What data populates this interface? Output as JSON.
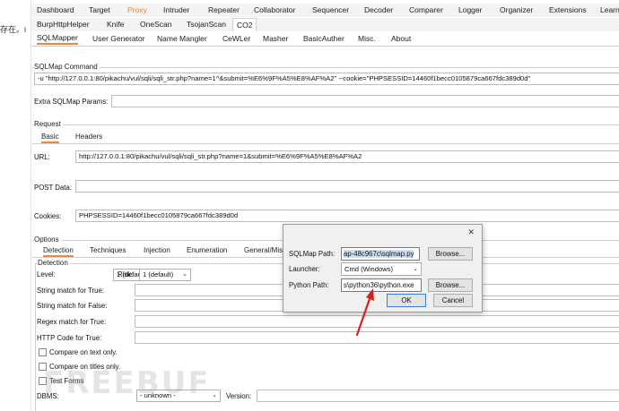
{
  "left_strip_text": "存在。i",
  "top_tabs": [
    "Dashboard",
    "Target",
    "Proxy",
    "Intruder",
    "Repeater",
    "Collaborator",
    "Sequencer",
    "Decoder",
    "Comparer",
    "Logger",
    "Organizer",
    "Extensions",
    "Learn"
  ],
  "ext_tabs": [
    "BurpHttpHelper",
    "Knife",
    "OneScan",
    "TsojanScan",
    "CO2"
  ],
  "co2_tabs": [
    "SQLMapper",
    "User Generator",
    "Name Mangler",
    "CeWLer",
    "Masher",
    "BasicAuther",
    "Misc.",
    "About"
  ],
  "sqlmap_command": {
    "title": "SQLMap Command",
    "value": "-u \"http://127.0.0.1:80/pikachu/vul/sqli/sqli_str.php?name=1^&submit=%E6%9F%A5%E8%AF%A2\" --cookie=\"PHPSESSID=14460f1becc0105879ca667fdc389d0d\"",
    "extra_label": "Extra SQLMap Params:",
    "extra_value": ""
  },
  "request": {
    "title": "Request",
    "tabs": [
      "Basic",
      "Headers"
    ],
    "url_label": "URL:",
    "url_value": "http://127.0.0.1:80/pikachu/vul/sqli/sqli_str.php?name=1&submit=%E6%9F%A5%E8%AF%A2",
    "post_label": "POST Data:",
    "post_value": "",
    "cookies_label": "Cookies:",
    "cookies_value": "PHPSESSID=14460f1becc0105879ca667fdc389d0d"
  },
  "options": {
    "title": "Options",
    "tabs": [
      "Detection",
      "Techniques",
      "Injection",
      "Enumeration",
      "General/Misc"
    ],
    "detection_title": "Detection",
    "level_label": "Level:",
    "level_value": "1 (default)",
    "risk_label": "Risk:",
    "risk_value": "1 (default)",
    "string_true_label": "String match for True:",
    "string_false_label": "String match for False:",
    "regex_true_label": "Regex match for True:",
    "http_code_label": "HTTP Code for True:",
    "compare_text_label": "Compare on text only.",
    "compare_titles_label": "Compare on titles only.",
    "test_forms_label": "Test Forms",
    "dbms_label": "DBMS:",
    "dbms_value": "- unknown -",
    "version_label": "Version:",
    "version_value": ""
  },
  "dialog": {
    "sqlmap_path_label": "SQLMap Path:",
    "sqlmap_path_value": "ap-48c967c\\sqlmap.py",
    "browse_label": "Browse...",
    "launcher_label": "Launcher:",
    "launcher_value": "Cmd (Windows)",
    "python_path_label": "Python Path:",
    "python_path_value": "s\\python36\\python.exe",
    "browse2_label": "Browse...",
    "ok_label": "OK",
    "cancel_label": "Cancel",
    "close_symbol": "✕"
  },
  "watermark": "FREEBUF",
  "colors": {
    "accent": "#e8893f",
    "arrow": "#d62020",
    "selection": "#cce0f5"
  }
}
